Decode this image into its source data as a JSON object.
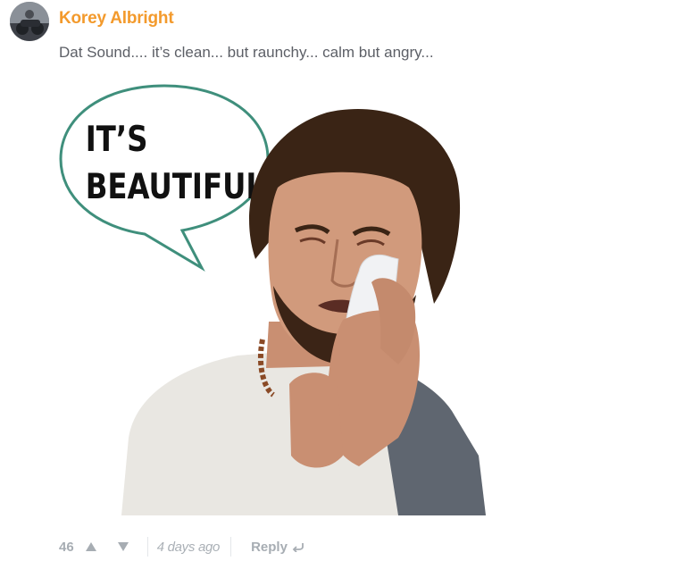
{
  "comment": {
    "author": "Korey Albright",
    "message": "Dat Sound.... it’s clean... but raunchy... calm but angry...",
    "image": {
      "caption_line1": "IT’S",
      "caption_line2": "BEAUTIFUL..."
    },
    "footer": {
      "votes": "46",
      "time": "4 days ago",
      "reply_label": "Reply"
    }
  },
  "colors": {
    "author": "#f39a2c",
    "text": "#5c5f66",
    "muted": "#a7adb3",
    "bubble_border": "#3f8f7c"
  },
  "icons": {
    "upvote": "triangle-up",
    "downvote": "triangle-down",
    "reply": "reply-arrow"
  }
}
